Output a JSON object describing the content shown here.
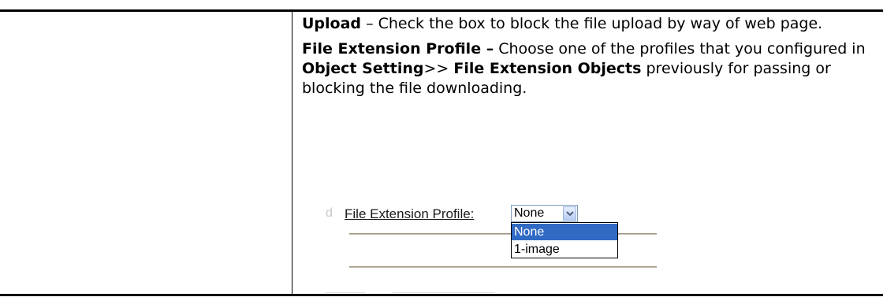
{
  "description_paragraphs": {
    "upload": {
      "term": "Upload",
      "text": " – Check the box to block the file upload by way of web page."
    },
    "file_extension_profile": {
      "term": "File Extension Profile –",
      "text_1": " Choose one of the profiles that you configured in ",
      "object_setting": "Object Setting",
      "arrow": ">> ",
      "file_extension_objects": "File Extension Objects",
      "text_2": " previously for passing or blocking the file downloading."
    }
  },
  "screenshot": {
    "fragment": "d",
    "label": "File Extension Profile:",
    "select": {
      "value": "None",
      "options": [
        "None",
        "1-image"
      ],
      "highlighted": "None"
    }
  },
  "colors": {
    "highlight": "#316ac5",
    "select_border": "#7f9db9"
  }
}
